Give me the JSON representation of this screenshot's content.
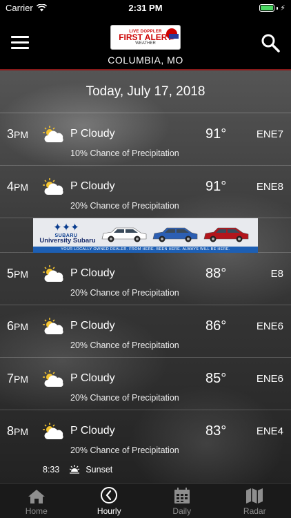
{
  "status_bar": {
    "carrier": "Carrier",
    "time": "2:31 PM",
    "wifi_icon": "wifi-icon",
    "battery_icon": "battery-icon"
  },
  "header": {
    "menu_icon": "hamburger-menu-icon",
    "logo": {
      "top": "LIVE DOPPLER",
      "main": "FIRST ALERT",
      "sub": "WEATHER"
    },
    "city": "COLUMBIA, MO",
    "search_icon": "search-icon",
    "accent_color": "#8a1a1a"
  },
  "date": "Today, July 17, 2018",
  "hours": [
    {
      "hour": "3",
      "ampm": "PM",
      "icon": "partly-cloudy-icon",
      "condition": "P Cloudy",
      "temp": "91°",
      "wind": "ENE7",
      "precip": "10% Chance of Precipitation"
    },
    {
      "hour": "4",
      "ampm": "PM",
      "icon": "partly-cloudy-icon",
      "condition": "P Cloudy",
      "temp": "91°",
      "wind": "ENE8",
      "precip": "20% Chance of Precipitation"
    },
    {
      "hour": "5",
      "ampm": "PM",
      "icon": "partly-cloudy-icon",
      "condition": "P Cloudy",
      "temp": "88°",
      "wind": "E8",
      "precip": "20% Chance of Precipitation"
    },
    {
      "hour": "6",
      "ampm": "PM",
      "icon": "partly-cloudy-icon",
      "condition": "P Cloudy",
      "temp": "86°",
      "wind": "ENE6",
      "precip": "20% Chance of Precipitation"
    },
    {
      "hour": "7",
      "ampm": "PM",
      "icon": "partly-cloudy-icon",
      "condition": "P Cloudy",
      "temp": "85°",
      "wind": "ENE6",
      "precip": "20% Chance of Precipitation"
    },
    {
      "hour": "8",
      "ampm": "PM",
      "icon": "partly-cloudy-icon",
      "condition": "P Cloudy",
      "temp": "83°",
      "wind": "ENE4",
      "precip": "20% Chance of Precipitation"
    }
  ],
  "sunset": {
    "time": "8:33",
    "label": "Sunset",
    "icon": "sunset-icon"
  },
  "ad": {
    "brand": "SUBARU",
    "dealer": "University Subaru",
    "tagline": "YOUR LOCALLY OWNED DEALER. FROM HERE. BEEN HERE. ALWAYS WILL BE HERE.",
    "car_colors": [
      "#ffffff",
      "#2c5fb3",
      "#b3151c"
    ]
  },
  "tabs": [
    {
      "label": "Home",
      "icon": "home-icon",
      "active": false
    },
    {
      "label": "Hourly",
      "icon": "clock-icon",
      "active": true
    },
    {
      "label": "Daily",
      "icon": "calendar-icon",
      "active": false
    },
    {
      "label": "Radar",
      "icon": "map-icon",
      "active": false
    }
  ]
}
